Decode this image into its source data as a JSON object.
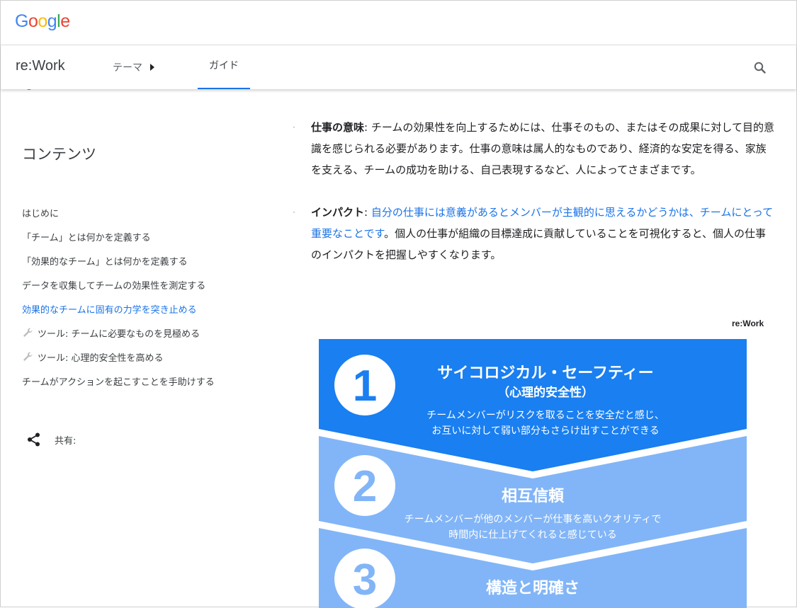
{
  "header": {
    "logo_letters": [
      "G",
      "o",
      "o",
      "g",
      "l",
      "e"
    ],
    "logo_colors": [
      "#4285F4",
      "#EA4335",
      "#FBBC05",
      "#4285F4",
      "#34A853",
      "#EA4335"
    ]
  },
  "nav": {
    "brand": "re:Work",
    "theme_label": "テーマ",
    "guide_label": "ガイド"
  },
  "sidebar": {
    "title": "コンテンツ",
    "items": [
      {
        "label": "はじめに"
      },
      {
        "label": "「チーム」とは何かを定義する"
      },
      {
        "label": "「効果的なチーム」とは何かを定義する"
      },
      {
        "label": "データを収集してチームの効果性を測定する"
      },
      {
        "label": "効果的なチームに固有の力学を突き止める"
      },
      {
        "label": "ツール: チームに必要なものを見極める"
      },
      {
        "label": "ツール: 心理的安全性を高める"
      },
      {
        "label": "チームがアクションを起こすことを手助けする"
      }
    ],
    "share_label": "共有:"
  },
  "article": {
    "bullet1": {
      "term": "仕事の意味",
      "sep": ": ",
      "text": "チームの効果性を向上するためには、仕事そのもの、またはその成果に対して目的意識を感じられる必要があります。仕事の意味は属人的なものであり、経済的な安定を得る、家族を支える、チームの成功を助ける、自己表現するなど、人によってさまざまです。"
    },
    "bullet2": {
      "term": "インパクト",
      "sep": ": ",
      "link": "自分の仕事には意義があるとメンバーが主観的に思えるかどうかは、チームにとって重要なことです",
      "text": "。個人の仕事が組織の目標達成に貢献していることを可視化すると、個人の仕事のインパクトを把握しやすくなります。"
    }
  },
  "infographic": {
    "credit": "re:Work",
    "colors": {
      "band1": "#1a7ff0",
      "band2": "#82b5f7",
      "band3": "#82b5f7"
    },
    "items": [
      {
        "number": "1",
        "title": "サイコロジカル・セーフティー",
        "subtitle": "（心理的安全性）",
        "desc1": "チームメンバーがリスクを取ることを安全だと感じ、",
        "desc2": "お互いに対して弱い部分もさらけ出すことができる"
      },
      {
        "number": "2",
        "title": "相互信頼",
        "desc1": "チームメンバーが他のメンバーが仕事を高いクオリティで",
        "desc2": "時間内に仕上げてくれると感じている"
      },
      {
        "number": "3",
        "title": "構造と明確さ"
      }
    ]
  }
}
